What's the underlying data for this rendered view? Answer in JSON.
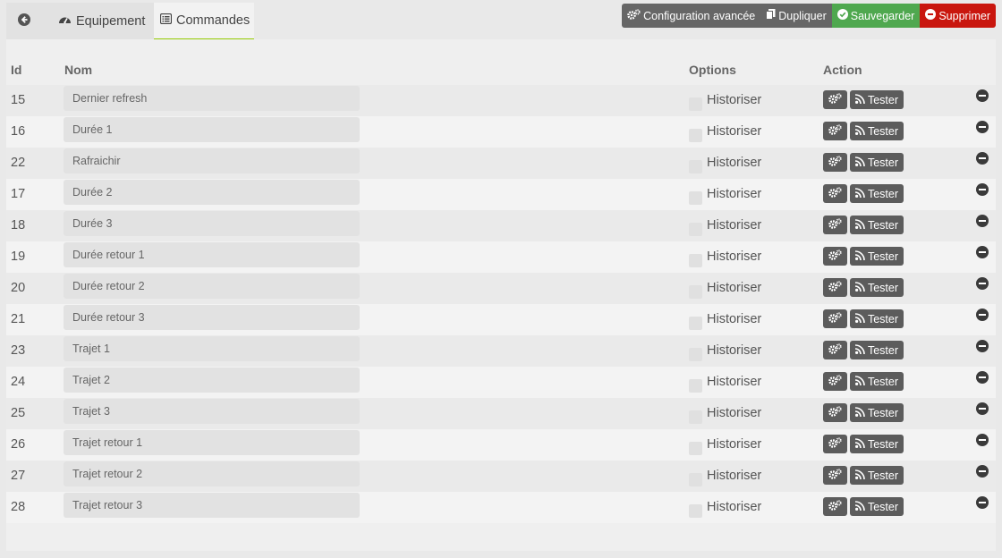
{
  "tabs": {
    "back_label": "",
    "equipement_label": "Equipement",
    "commandes_label": "Commandes"
  },
  "toolbar": {
    "config_label": "Configuration avancée",
    "duplicate_label": "Dupliquer",
    "save_label": "Sauvegarder",
    "delete_label": "Supprimer"
  },
  "colors": {
    "active_tab_border": "#94ca02",
    "save": "#4fa84f",
    "delete": "#c9160e",
    "grey_button": "#666666"
  },
  "table": {
    "headers": {
      "id": "Id",
      "nom": "Nom",
      "options": "Options",
      "action": "Action"
    },
    "option_label": "Historiser",
    "test_label": "Tester",
    "rows": [
      {
        "id": "15",
        "name": "Dernier refresh"
      },
      {
        "id": "16",
        "name": "Durée 1"
      },
      {
        "id": "22",
        "name": "Rafraichir"
      },
      {
        "id": "17",
        "name": "Durée 2"
      },
      {
        "id": "18",
        "name": "Durée 3"
      },
      {
        "id": "19",
        "name": "Durée retour 1"
      },
      {
        "id": "20",
        "name": "Durée retour 2"
      },
      {
        "id": "21",
        "name": "Durée retour 3"
      },
      {
        "id": "23",
        "name": "Trajet 1"
      },
      {
        "id": "24",
        "name": "Trajet 2"
      },
      {
        "id": "25",
        "name": "Trajet 3"
      },
      {
        "id": "26",
        "name": "Trajet retour 1"
      },
      {
        "id": "27",
        "name": "Trajet retour 2"
      },
      {
        "id": "28",
        "name": "Trajet retour 3"
      }
    ]
  }
}
